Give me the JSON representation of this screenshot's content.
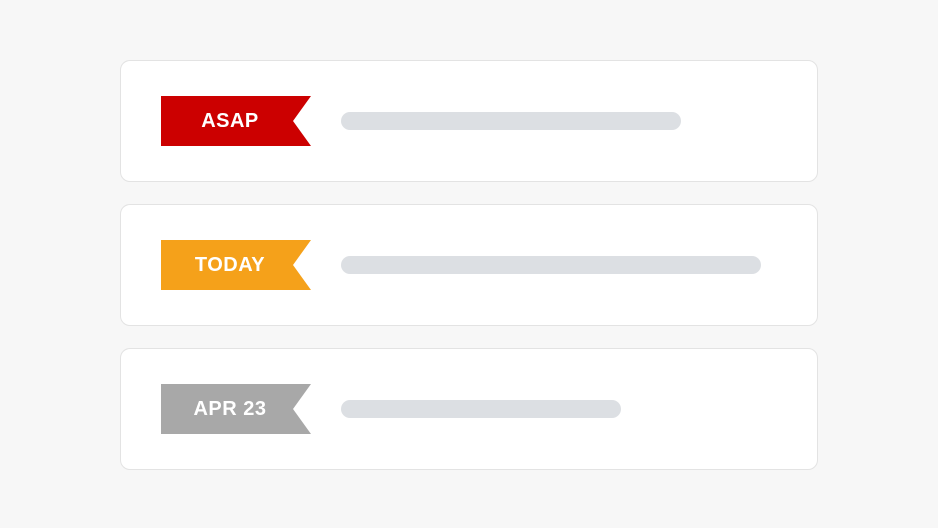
{
  "tasks": [
    {
      "priority_label": "ASAP",
      "priority_kind": "asap"
    },
    {
      "priority_label": "TODAY",
      "priority_kind": "today"
    },
    {
      "priority_label": "APR 23",
      "priority_kind": "date"
    }
  ],
  "colors": {
    "asap": "#cc0000",
    "today": "#f5a11a",
    "date": "#a8a8a8",
    "placeholder": "#dcdfe3",
    "card_border": "#e3e3e3",
    "page_bg": "#f7f7f7"
  }
}
